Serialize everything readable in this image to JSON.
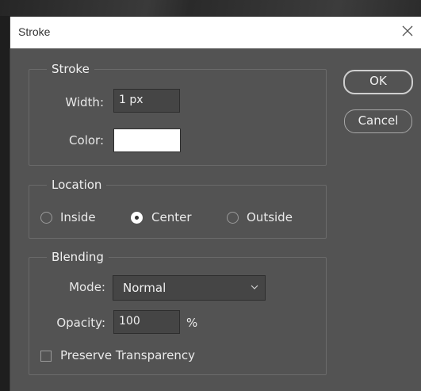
{
  "dialog": {
    "title": "Stroke",
    "ok_label": "OK",
    "cancel_label": "Cancel"
  },
  "stroke": {
    "legend": "Stroke",
    "width_label": "Width:",
    "width_value": "1 px",
    "color_label": "Color:",
    "color_value": "#ffffff"
  },
  "location": {
    "legend": "Location",
    "options": [
      "Inside",
      "Center",
      "Outside"
    ],
    "selected": "Center"
  },
  "blending": {
    "legend": "Blending",
    "mode_label": "Mode:",
    "mode_value": "Normal",
    "opacity_label": "Opacity:",
    "opacity_value": "100",
    "opacity_unit": "%",
    "preserve_label": "Preserve Transparency",
    "preserve_checked": false
  }
}
